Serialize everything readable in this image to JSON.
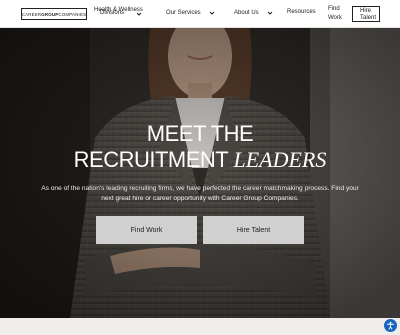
{
  "header": {
    "logo": {
      "prefix": "CAREER",
      "bold": "GROUP",
      "suffix": "COMPANIES"
    },
    "nav": [
      {
        "label": "Divisions",
        "overlap": "Health & Wellness"
      },
      {
        "label": "Our Services"
      },
      {
        "label": "About Us"
      },
      {
        "label": "Resources"
      }
    ],
    "find_work": "Find Work",
    "hire_talent": "Hire Talent"
  },
  "hero": {
    "title_line1": "MEET THE",
    "title_line2_plain": "RECRUITMENT ",
    "title_line2_accent": "LEADERS",
    "subtitle": "As one of the nation's leading recruiting firms, we have perfected the career matchmaking process. Find your next great hire or career opportunity with Career Group Companies.",
    "cta_primary": "Find Work",
    "cta_secondary": "Hire Talent"
  },
  "icons": {
    "chevron": "chevron-down-icon",
    "accessibility": "accessibility-icon"
  }
}
